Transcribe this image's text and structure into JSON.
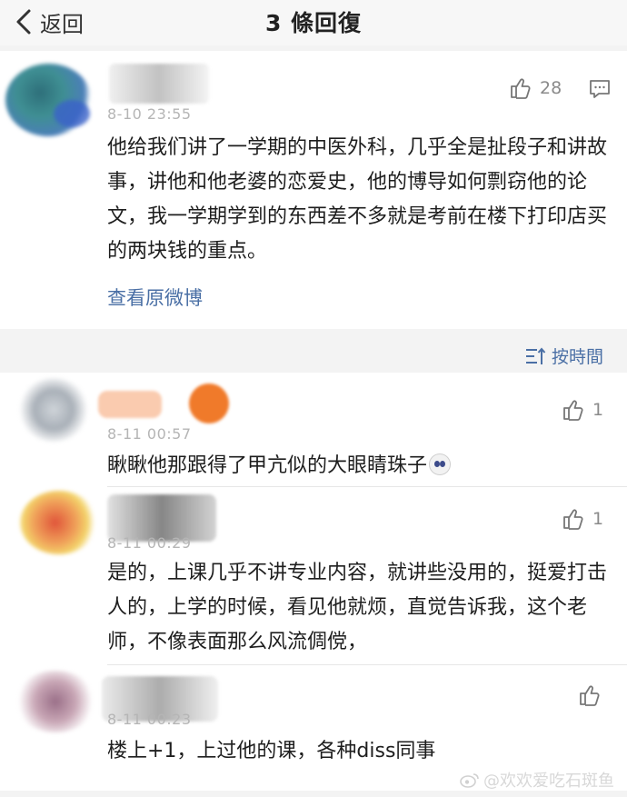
{
  "navbar": {
    "back_label": "返回",
    "title": "3 條回復"
  },
  "main_comment": {
    "timestamp": "8-10 23:55",
    "like_count": "28",
    "text": "他给我们讲了一学期的中医外科，几乎全是扯段子和讲故事，讲他和他老婆的恋爱史，他的博导如何剽窃他的论文，我一学期学到的东西差不多就是考前在楼下打印店买的两块钱的重点。",
    "view_original_label": "查看原微博"
  },
  "sort": {
    "label": "按時間"
  },
  "replies": [
    {
      "timestamp": "8-11 00:57",
      "like_count": "1",
      "text": "瞅瞅他那跟得了甲亢似的大眼睛珠子"
    },
    {
      "timestamp": "8-11 00:29",
      "like_count": "1",
      "text": "是的，上课几乎不讲专业内容，就讲些没用的，挺爱打击人的，上学的时候，看见他就烦，直觉告诉我，这个老师，不像表面那么风流倜傥，"
    },
    {
      "timestamp": "8-11 00:23",
      "like_count": "",
      "text": "楼上+1，上过他的课，各种diss同事"
    }
  ],
  "watermark": {
    "text": "@欢欢爱吃石斑鱼"
  },
  "colors": {
    "link": "#4a6fa5",
    "timestamp": "#b5b5b5",
    "background": "#f3f3f3"
  }
}
